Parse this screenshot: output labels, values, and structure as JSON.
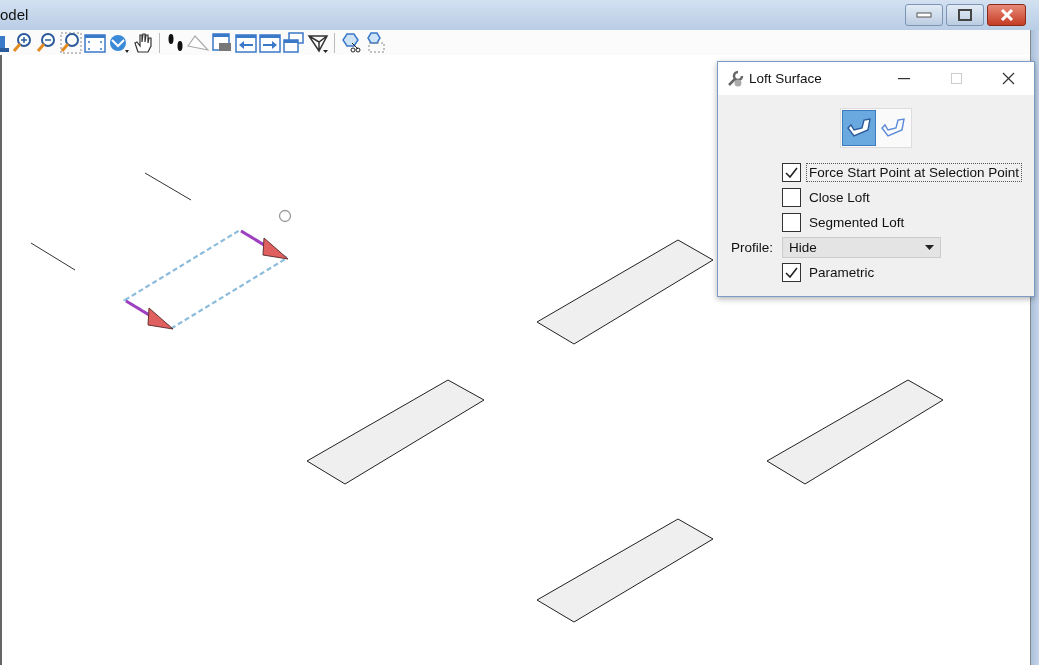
{
  "window": {
    "title": "odel"
  },
  "dialog": {
    "title": "Loft Surface",
    "modes": [
      {
        "selected": true
      },
      {
        "selected": false
      }
    ],
    "options": [
      {
        "label": "Force Start Point at Selection Point",
        "checked": true,
        "focused": true
      },
      {
        "label": "Close Loft",
        "checked": false,
        "focused": false
      },
      {
        "label": "Segmented Loft",
        "checked": false,
        "focused": false
      }
    ],
    "profile": {
      "label": "Profile:",
      "value": "Hide"
    },
    "parametric": {
      "label": "Parametric",
      "checked": true
    }
  }
}
